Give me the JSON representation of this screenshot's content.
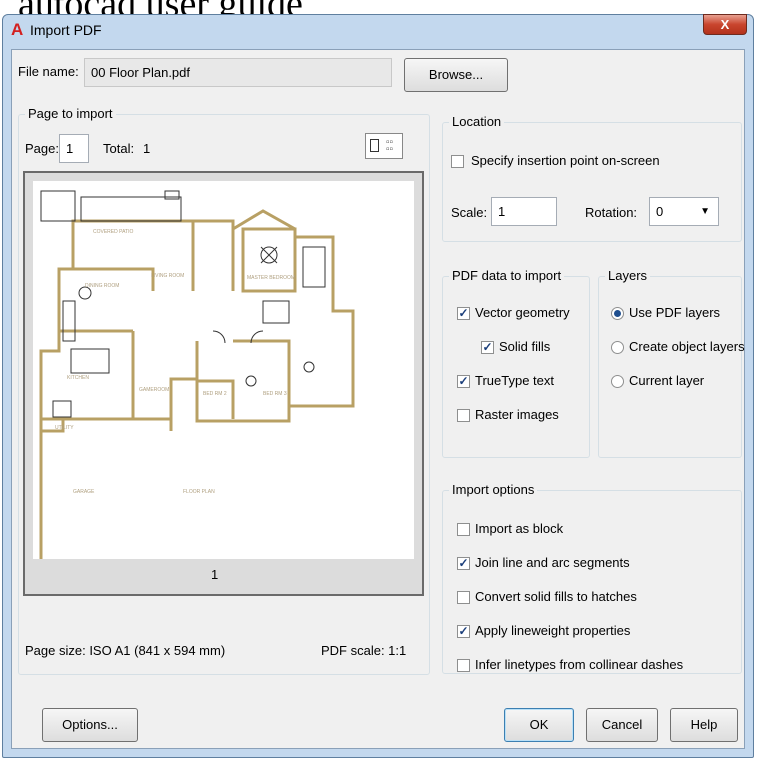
{
  "banner_text": "autocad user guide",
  "window": {
    "title": "Import PDF",
    "close_label": "X"
  },
  "file": {
    "label": "File name:",
    "value": "00 Floor Plan.pdf",
    "browse_label": "Browse..."
  },
  "page_to_import": {
    "title": "Page to import",
    "page_label": "Page:",
    "page_value": "1",
    "total_label": "Total:",
    "total_value": "1",
    "preview_page_number": "1",
    "preview_room_labels": [
      "COVERED PATIO",
      "DINING ROOM",
      "LIVING ROOM",
      "MASTER BEDROOM",
      "KITCHEN",
      "GAMEROOM",
      "BED RM 2",
      "BED RM 3",
      "GARAGE",
      "FLOOR PLAN",
      "UTILITY"
    ],
    "page_size": "Page size: ISO A1 (841 x 594 mm)",
    "pdf_scale": "PDF scale: 1:1"
  },
  "location": {
    "title": "Location",
    "specify_label": "Specify insertion point on-screen",
    "specify_checked": false,
    "scale_label": "Scale:",
    "scale_value": "1",
    "rotation_label": "Rotation:",
    "rotation_value": "0"
  },
  "pdf_data": {
    "title": "PDF data to import",
    "vector_label": "Vector geometry",
    "vector_checked": true,
    "solid_label": "Solid fills",
    "solid_checked": true,
    "truetype_label": "TrueType text",
    "truetype_checked": true,
    "raster_label": "Raster images",
    "raster_checked": false
  },
  "layers": {
    "title": "Layers",
    "options": [
      "Use PDF layers",
      "Create object layers",
      "Current layer"
    ],
    "selected": "Use PDF layers"
  },
  "import_options": {
    "title": "Import options",
    "items": [
      {
        "label": "Import as block",
        "checked": false
      },
      {
        "label": "Join line and arc segments",
        "checked": true
      },
      {
        "label": "Convert solid fills to hatches",
        "checked": false
      },
      {
        "label": "Apply lineweight properties",
        "checked": true
      },
      {
        "label": "Infer linetypes from collinear dashes",
        "checked": false
      }
    ]
  },
  "buttons": {
    "options_label": "Options...",
    "ok_label": "OK",
    "cancel_label": "Cancel",
    "help_label": "Help"
  },
  "colors": {
    "accent_blue": "#1f4f8f",
    "title_bar": "#c3d8ee",
    "wall_tan": "#b8a064"
  }
}
